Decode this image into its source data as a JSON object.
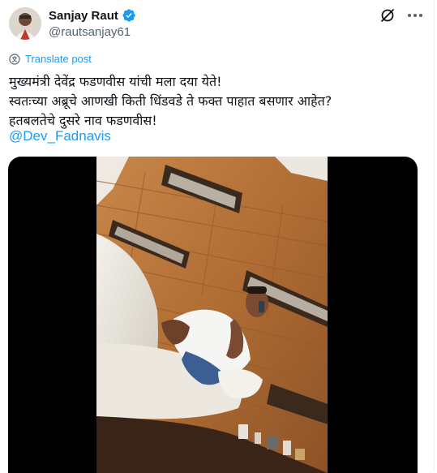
{
  "author": {
    "display_name": "Sanjay Raut",
    "handle": "@rautsanjay61",
    "verified": true
  },
  "actions": {
    "grok_icon": "grok-icon",
    "more_icon": "more-icon"
  },
  "translate": {
    "label": "Translate post"
  },
  "tweet": {
    "lines": [
      "मुख्यमंत्री देवेंद्र फडणवीस यांची मला दया येते!",
      "स्वतःच्या अब्रूचे आणखी किती धिंडवडे ते फक्त पाहात बसणार आहेत?",
      "हतबलतेचे दुसरे नाव फडणवीस!"
    ],
    "mention": "@Dev_Fadnavis"
  },
  "colors": {
    "accent": "#1d9bf0",
    "text": "#0f1419",
    "secondary": "#536471",
    "wood": "#b7773c"
  }
}
